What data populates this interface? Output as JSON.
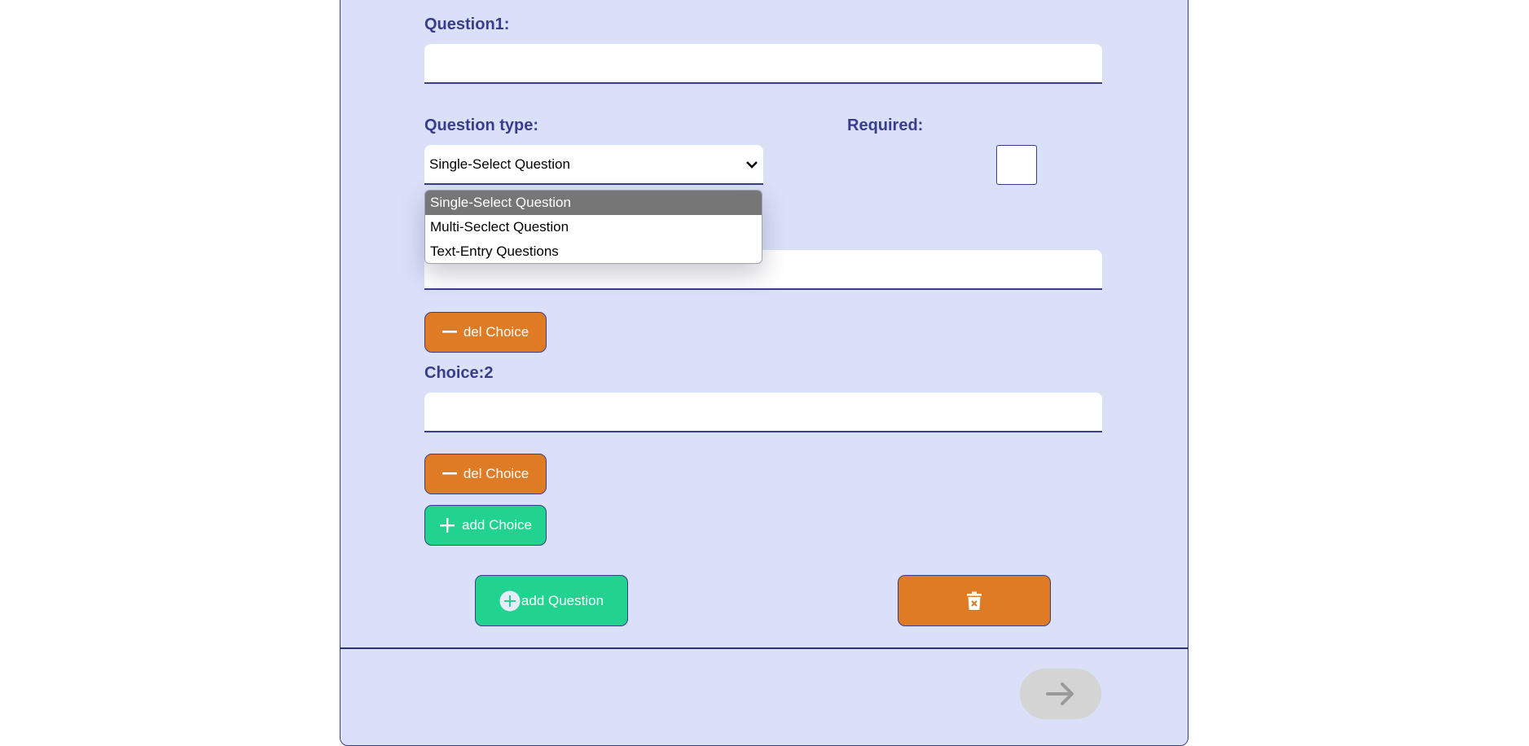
{
  "question": {
    "label": "Question1:",
    "value": ""
  },
  "question_type": {
    "label": "Question type:",
    "selected": "Single-Select Question",
    "options": [
      "Single-Select Question",
      "Multi-Seclect Question",
      "Text-Entry Questions"
    ]
  },
  "required": {
    "label": "Required:",
    "checked": false
  },
  "choices": [
    {
      "value": "",
      "del_label": "del Choice"
    },
    {
      "label": "Choice:2",
      "value": "",
      "del_label": "del Choice"
    }
  ],
  "add_choice_label": "add Choice",
  "add_question_label": "add Question",
  "icons": {
    "minus": "minus-icon",
    "plus": "plus-icon",
    "plus_circle": "plus-circle-icon",
    "trash": "trash-icon",
    "arrow_right": "arrow-right-icon",
    "chevron": "chevron-down-icon"
  },
  "colors": {
    "panel": "#dae0f8",
    "label": "#3a3d8c",
    "orange": "#e07b25",
    "green": "#22d28f",
    "disabled": "#d4d4d4"
  }
}
